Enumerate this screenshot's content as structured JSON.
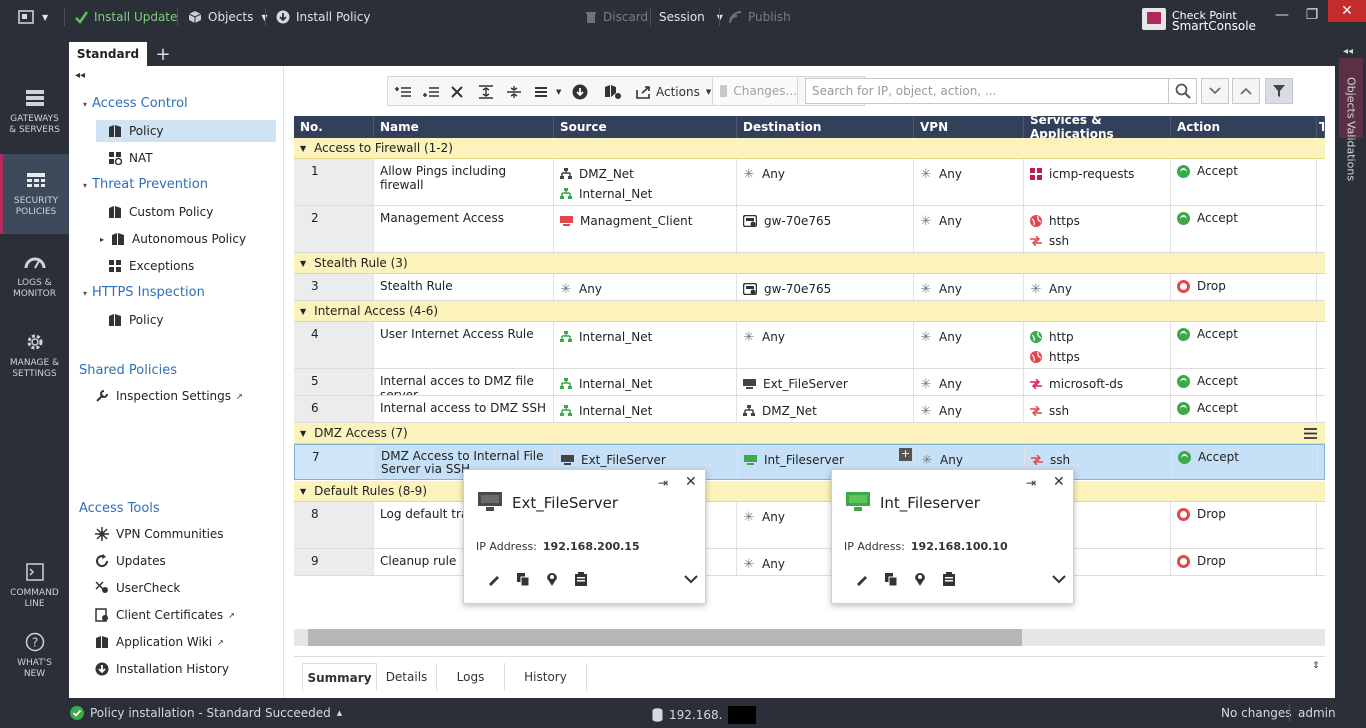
{
  "topbar": {
    "install_update": "Install Update",
    "objects": "Objects",
    "install_policy": "Install Policy",
    "discard": "Discard",
    "session": "Session",
    "publish": "Publish",
    "brand_line1": "Check Point",
    "brand_line2": "SmartConsole"
  },
  "leftnav": {
    "gateways": [
      "GATEWAYS",
      "& SERVERS"
    ],
    "security": [
      "SECURITY",
      "POLICIES"
    ],
    "logs": [
      "LOGS &",
      "MONITOR"
    ],
    "manage": [
      "MANAGE &",
      "SETTINGS"
    ],
    "cmdline": [
      "COMMAND",
      "LINE"
    ],
    "whatsnew": [
      "WHAT'S",
      "NEW"
    ]
  },
  "tabs": {
    "standard": "Standard",
    "add": "+"
  },
  "tree": {
    "access_control": "Access Control",
    "policy": "Policy",
    "nat": "NAT",
    "threat_prevention": "Threat Prevention",
    "custom_policy": "Custom Policy",
    "autonomous_policy": "Autonomous Policy",
    "exceptions": "Exceptions",
    "https_inspection": "HTTPS Inspection",
    "https_policy": "Policy",
    "shared_policies": "Shared Policies",
    "inspection_settings": "Inspection Settings",
    "access_tools": "Access Tools",
    "vpn_communities": "VPN Communities",
    "updates": "Updates",
    "usercheck": "UserCheck",
    "client_certificates": "Client Certificates",
    "application_wiki": "Application Wiki",
    "installation_history": "Installation History"
  },
  "toolbar": {
    "actions": "Actions",
    "changes": "Changes...",
    "search_placeholder": "Search for IP, object, action, ..."
  },
  "rightstrip": {
    "objects": "Objects",
    "validations": "Validations"
  },
  "grid": {
    "columns": [
      "No.",
      "Name",
      "Source",
      "Destination",
      "VPN",
      "Services & Applications",
      "Action",
      "T"
    ],
    "sections": [
      {
        "label": "Access to Firewall",
        "range": "(1-2)"
      },
      {
        "label": "Stealth Rule",
        "range": "(3)"
      },
      {
        "label": "Internal Access",
        "range": "(4-6)"
      },
      {
        "label": "DMZ Access",
        "range": "(7)"
      },
      {
        "label": "Default Rules",
        "range": "(8-9)"
      }
    ],
    "rows": [
      {
        "no": "1",
        "name": "Allow Pings including firewall",
        "source": [
          "DMZ_Net",
          "Internal_Net"
        ],
        "destination": [
          "Any"
        ],
        "vpn": "Any",
        "services": [
          "icmp-requests"
        ],
        "action": "Accept"
      },
      {
        "no": "2",
        "name": "Management Access",
        "source": [
          "Managment_Client"
        ],
        "destination": [
          "gw-70e765"
        ],
        "vpn": "Any",
        "services": [
          "https",
          "ssh"
        ],
        "action": "Accept"
      },
      {
        "no": "3",
        "name": "Stealth Rule",
        "source": [
          "Any"
        ],
        "destination": [
          "gw-70e765"
        ],
        "vpn": "Any",
        "services": [
          "Any"
        ],
        "action": "Drop"
      },
      {
        "no": "4",
        "name": "User Internet Access Rule",
        "source": [
          "Internal_Net"
        ],
        "destination": [
          "Any"
        ],
        "vpn": "Any",
        "services": [
          "http",
          "https"
        ],
        "action": "Accept"
      },
      {
        "no": "5",
        "name": "Internal acces to DMZ file server",
        "source": [
          "Internal_Net"
        ],
        "destination": [
          "Ext_FileServer"
        ],
        "vpn": "Any",
        "services": [
          "microsoft-ds"
        ],
        "action": "Accept"
      },
      {
        "no": "6",
        "name": "Internal access to DMZ SSH",
        "source": [
          "Internal_Net"
        ],
        "destination": [
          "DMZ_Net"
        ],
        "vpn": "Any",
        "services": [
          "ssh"
        ],
        "action": "Accept"
      },
      {
        "no": "7",
        "name_l1": "DMZ Access to Internal File",
        "name_l2": "Server via SSH",
        "source": [
          "Ext_FileServer"
        ],
        "destination": [
          "Int_Fileserver"
        ],
        "vpn": "Any",
        "services": [
          "ssh"
        ],
        "action": "Accept"
      },
      {
        "no": "8",
        "name": "Log default traff",
        "destination": [
          "Any"
        ],
        "action": "Drop"
      },
      {
        "no": "9",
        "name": "Cleanup rule",
        "destination": [
          "Any"
        ],
        "action": "Drop"
      }
    ]
  },
  "popups": [
    {
      "title": "Ext_FileServer",
      "ip_label": "IP Address:",
      "ip": "192.168.200.15"
    },
    {
      "title": "Int_Fileserver",
      "ip_label": "IP Address:",
      "ip": "192.168.100.10"
    }
  ],
  "bottom_tabs": [
    "Summary",
    "Details",
    "Logs",
    "History"
  ],
  "status": {
    "install_msg": "Policy installation - Standard Succeeded",
    "server": "192.168.",
    "changes": "No changes",
    "user": "admin"
  },
  "colors": {
    "accent_magenta": "#b22d5b",
    "header_navy": "#33405a",
    "section_yellow": "#fbf2bc",
    "selected_row": "#c6e0f7",
    "accept_green": "#3ba84a",
    "drop_red": "#e2474c",
    "link_blue": "#2f6fb5"
  }
}
